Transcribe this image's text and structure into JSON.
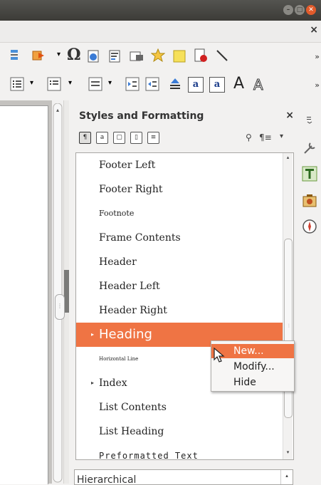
{
  "window": {
    "minimize_icon": "minimize-icon",
    "maximize_icon": "maximize-icon",
    "close_icon": "close-icon",
    "close_glyph": "✕"
  },
  "menubar": {
    "close_doc_label": "×"
  },
  "toolbar1": {
    "icons": [
      "page-break-icon",
      "insert-field-icon",
      "dropdown-icon",
      "special-character-icon",
      "hyperlink-icon",
      "footnote-icon",
      "comment-icon",
      "bookmark-icon",
      "note-icon",
      "track-changes-icon",
      "line-icon"
    ],
    "dropdown_glyph": "▾",
    "omega": "Ω",
    "more": "»"
  },
  "toolbar2": {
    "icons": [
      "bullets-icon",
      "numbering-icon",
      "outline-icon",
      "paragraph-spacing-icon",
      "indent-increase-icon",
      "indent-decrease-icon",
      "anchor-icon",
      "superscript-icon",
      "subscript-icon",
      "font-size-up-icon",
      "font-size-down-icon"
    ],
    "dropdown_glyph": "▾",
    "more": "»",
    "sup_label": "a",
    "sub_label": "a",
    "big_a": "A",
    "outline_a": "A"
  },
  "styles_panel": {
    "title": "Styles and Formatting",
    "close": "×",
    "family_buttons": [
      "paragraph-styles",
      "character-styles",
      "frame-styles",
      "page-styles",
      "list-styles"
    ],
    "fill_format_icon": "fill-format-icon",
    "new_style_icon": "new-style-icon",
    "menu_glyph": "▾",
    "items": [
      {
        "label": "Footer Left",
        "style": "normal"
      },
      {
        "label": "Footer Right",
        "style": "normal"
      },
      {
        "label": "Footnote",
        "style": "small"
      },
      {
        "label": "Frame Contents",
        "style": "normal"
      },
      {
        "label": "Header",
        "style": "normal"
      },
      {
        "label": "Header Left",
        "style": "normal"
      },
      {
        "label": "Header Right",
        "style": "normal"
      },
      {
        "label": "Heading",
        "style": "selected",
        "expander": "▸"
      },
      {
        "label": "Horizontal Line",
        "style": "tiny"
      },
      {
        "label": "Index",
        "style": "normal",
        "expander": "▸"
      },
      {
        "label": "List Contents",
        "style": "normal"
      },
      {
        "label": "List Heading",
        "style": "normal"
      },
      {
        "label": "Preformatted Text",
        "style": "mono"
      }
    ],
    "filter_value": "Hierarchical",
    "scroll_up": "▴",
    "scroll_down": "▾"
  },
  "context_menu": {
    "new": "New...",
    "modify": "Modify...",
    "hide": "Hide"
  },
  "deck": {
    "icons": [
      "properties-icon",
      "styles-icon",
      "gallery-icon",
      "navigator-icon"
    ]
  },
  "colors": {
    "accent": "#ef7444",
    "titlebar": "#3c3b37"
  }
}
